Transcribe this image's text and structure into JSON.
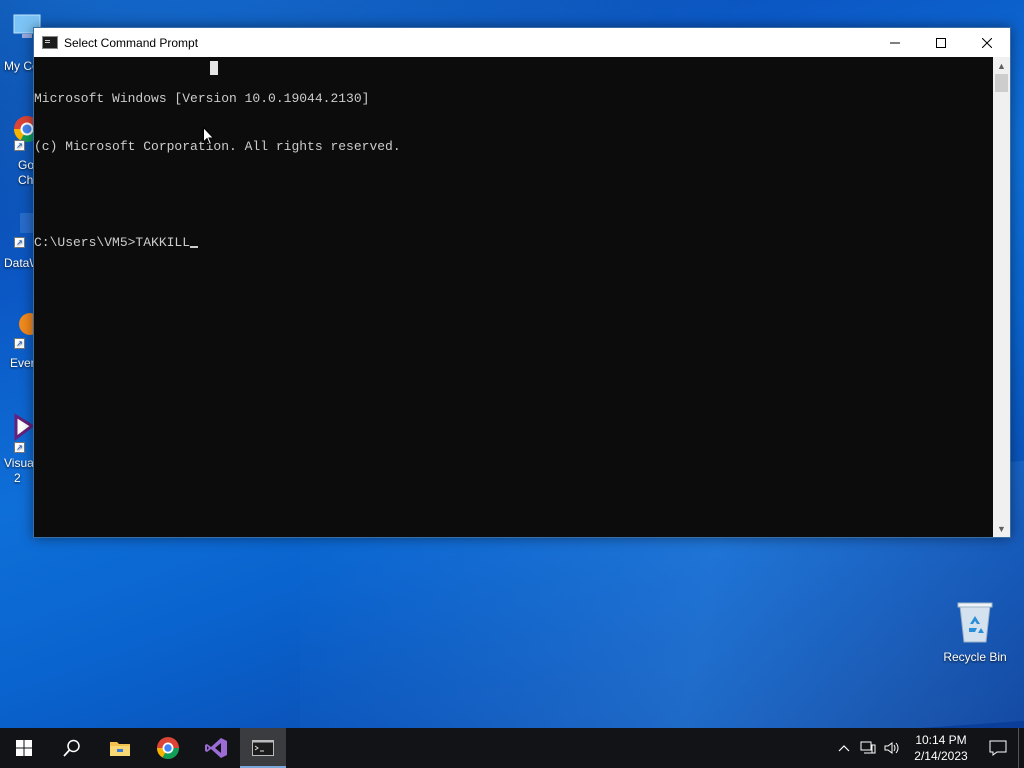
{
  "desktop": {
    "icons": [
      {
        "label": "My Co",
        "icon": "computer-icon"
      },
      {
        "label": "Go\nCh",
        "icon": "chrome-icon"
      },
      {
        "label": "DataW",
        "icon": "datawrapper-icon"
      },
      {
        "label": "Ever",
        "icon": "evernote-icon"
      },
      {
        "label": "Visua\n2",
        "icon": "visual-studio-icon"
      }
    ],
    "recycle_bin_label": "Recycle Bin"
  },
  "window": {
    "title": "Select Command Prompt",
    "icon": "cmd-icon",
    "buttons": {
      "minimize": "minimize-icon",
      "maximize": "maximize-icon",
      "close": "close-icon"
    }
  },
  "console": {
    "lines": [
      "Microsoft Windows [Version 10.0.19044.2130]",
      "(c) Microsoft Corporation. All rights reserved.",
      "",
      "C:\\Users\\VM5>TAKKILL"
    ]
  },
  "taskbar": {
    "items": [
      "start-icon",
      "search-icon",
      "file-explorer-icon",
      "chrome-icon",
      "visual-studio-icon",
      "cmd-icon"
    ],
    "tray": {
      "time": "10:14 PM",
      "date": "2/14/2023"
    }
  },
  "colors": {
    "console_bg": "#0c0c0c",
    "console_fg": "#cccccc",
    "taskbar_bg": "#111317",
    "accent": "#0b57c4"
  }
}
